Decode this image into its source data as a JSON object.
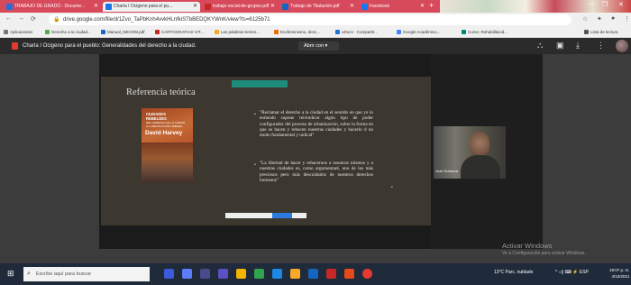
{
  "browser": {
    "tabs": [
      {
        "label": "TRABAJO DE GRADO - Docume...",
        "fav_color": "#2a6dd8"
      },
      {
        "label": "Charla I Ocigeno para el pu...",
        "fav_color": "#1a73e8"
      },
      {
        "label": "trabajo-social-de-grupos.pdf",
        "fav_color": "#c62828"
      },
      {
        "label": "Trabajo de Titulación.pdf",
        "fav_color": "#1565c0"
      },
      {
        "label": "Facebook",
        "fav_color": "#1877f2"
      }
    ],
    "url": "drive.google.com/file/d/1Zvo_TaPbKnh4vvkHLnfkiSTbBEDQKYWnK/view?ts=6125b71",
    "bookmarks": [
      {
        "label": "Aplicaciones",
        "color": "#777"
      },
      {
        "label": "Derecho a la ciudad...",
        "color": "#4caf50"
      },
      {
        "label": "Manual_IMICOM.pdf",
        "color": "#1565c0"
      },
      {
        "label": "CARTOGRAFIAS VIT...",
        "color": "#c62828"
      },
      {
        "label": "Las palabras tienen...",
        "color": "#f9a825"
      },
      {
        "label": "Ecofeminismo, desc...",
        "color": "#ef6c00"
      },
      {
        "label": "uDocs - Compartir...",
        "color": "#1976d2"
      },
      {
        "label": "Google Académico...",
        "color": "#4285f4"
      },
      {
        "label": "Curso: Rehabilitacid...",
        "color": "#00897b"
      },
      {
        "label": "Lista de lectura",
        "color": "#555"
      }
    ]
  },
  "viewer": {
    "doc_title": "Charla I Ocigeno para el pueblo: Generalidades del derecho a la ciudad.",
    "open_with": "Abrir con  ▾"
  },
  "slide": {
    "title": "Referencia teórica",
    "book_lines": [
      "CIUDADES",
      "REBELDES",
      "DEL DERECHO DE LA CIUDAD",
      "A LA REVOLUCIÓN URBANA"
    ],
    "book_author": "David Harvey",
    "quote1": "\"Reclamar el derecho a la ciudad en el sentido en que yo lo entiendo supone reivindicar algún tipo de poder configurador del proceso de urbanización, sobre la forma en que se hacen y rehacen nuestras ciudades y hacerlo d un modo fundamental y radical\"",
    "quote2": "\"La libertad de hacer y rehacernos a nosotros mismos y a nuestras ciudades es, como argumentaré, uno de los más preciosos pero más descuidados de nuestros derechos humanos\""
  },
  "camera": {
    "name": "Juan Sotoarra"
  },
  "activate": {
    "line1": "Activar Windows",
    "line2": "Ve a Configuración para activar Windows."
  },
  "taskbar": {
    "search_placeholder": "Escribe aquí para buscar",
    "apps": [
      {
        "color": "#3b5bdb"
      },
      {
        "color": "#5c7cfa"
      },
      {
        "color": "#4a4a8a"
      },
      {
        "color": "#5d4fc6"
      },
      {
        "color": "#f4b400"
      },
      {
        "color": "#2ea44f"
      },
      {
        "color": "#1e88e5"
      },
      {
        "color": "#f9a825"
      },
      {
        "color": "#1565c0"
      },
      {
        "color": "#c62828"
      },
      {
        "color": "#e64a19"
      },
      {
        "color": "#e53935"
      }
    ],
    "weather": "13°C  Parc. nublado",
    "tray_icons": "^  ◁)  ⌨  ⚡  ESP",
    "time": "19:07 p. m.",
    "date": "4/10/2021"
  }
}
